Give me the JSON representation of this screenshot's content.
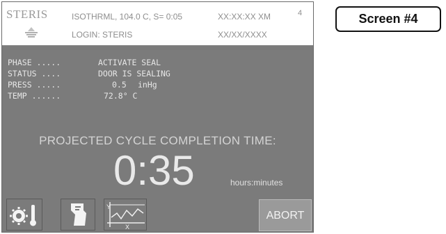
{
  "header": {
    "logo_text": "STERIS",
    "logo_mark": "®",
    "cycle_info": "ISOTHRML, 104.0 C, S= 0:05",
    "time": "XX:XX:XX XM",
    "screen_number": "4",
    "login": "LOGIN: STERIS",
    "date": "XX/XX/XXXX"
  },
  "readout": {
    "phase_label": "PHASE .....",
    "phase_value": "ACTIVATE SEAL",
    "status_label": "STATUS ....",
    "status_value": "DOOR IS SEALING",
    "press_label": "PRESS .....",
    "press_value": "0.5",
    "press_unit": "inHg",
    "temp_label": "TEMP ......",
    "temp_value": "72.8° C"
  },
  "projection": {
    "label": "PROJECTED CYCLE COMPLETION TIME:",
    "time": "0:35",
    "units": "hours:minutes"
  },
  "buttons": {
    "abort_label": "ABORT",
    "chart_icon_y": "Y",
    "chart_icon_x": "X"
  },
  "screen_tag": "Screen #4",
  "icons": [
    "temperature-dial-icon",
    "printer-report-icon",
    "graph-icon"
  ]
}
